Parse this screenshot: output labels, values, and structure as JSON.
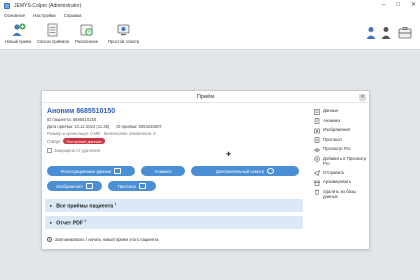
{
  "window": {
    "title": "JEMYS-Colpro (Administrator)"
  },
  "menu": [
    "Основное",
    "Настройки",
    "Справка"
  ],
  "toolbar": {
    "new_visit": "Новый приём",
    "visit_list": "Список приёмов",
    "schedule": "Расписание",
    "video_call": "Простой осмотр"
  },
  "dialog": {
    "title": "Приём",
    "patient_name": "Аноним 8685510150",
    "patient_id": "ID пациента: 8685510150",
    "visit_date": "Дата приёма: 10.12.2024 (11:35)",
    "visit_id": "ID приёма: 5094233607",
    "ai_info": "Размер в хранилище: 0 МБ · Количество элементов: 0",
    "status_label": "Статус:",
    "status_value": "Поступают данные",
    "protect_label": "Защищено от удаления",
    "buttons_row1": [
      "Регистрационные данные",
      "Анамнез",
      "Дополнительный осмотр"
    ],
    "buttons_row2": [
      "Изображения",
      "Протокол"
    ],
    "all_visits": "Все приёмы пациента",
    "all_visits_count": "1",
    "report_pdf": "Отчет PDF",
    "report_count": "0",
    "footer": "Запланировать / начать новый приём этого пациента"
  },
  "side_panel": [
    {
      "label": "Данные",
      "icon": "data-icon"
    },
    {
      "label": "Анамнез",
      "icon": "anamnesis-icon"
    },
    {
      "label": "Изображения",
      "icon": "images-icon"
    },
    {
      "label": "Протокол",
      "icon": "protocol-icon"
    },
    {
      "label": "Просмотр Pro",
      "icon": "view-pro-icon"
    },
    {
      "label": "Добавить в Просмотр Pro",
      "icon": "add-view-pro-icon"
    },
    {
      "label": "Отправить",
      "icon": "send-icon"
    },
    {
      "label": "Архивировать",
      "icon": "archive-icon"
    },
    {
      "label": "Удалить из базы данных",
      "icon": "delete-icon"
    }
  ],
  "colors": {
    "accent": "#4a8fd4",
    "status": "#cc3344",
    "link": "#2a5cab",
    "accordion": "#dbe9f7"
  }
}
